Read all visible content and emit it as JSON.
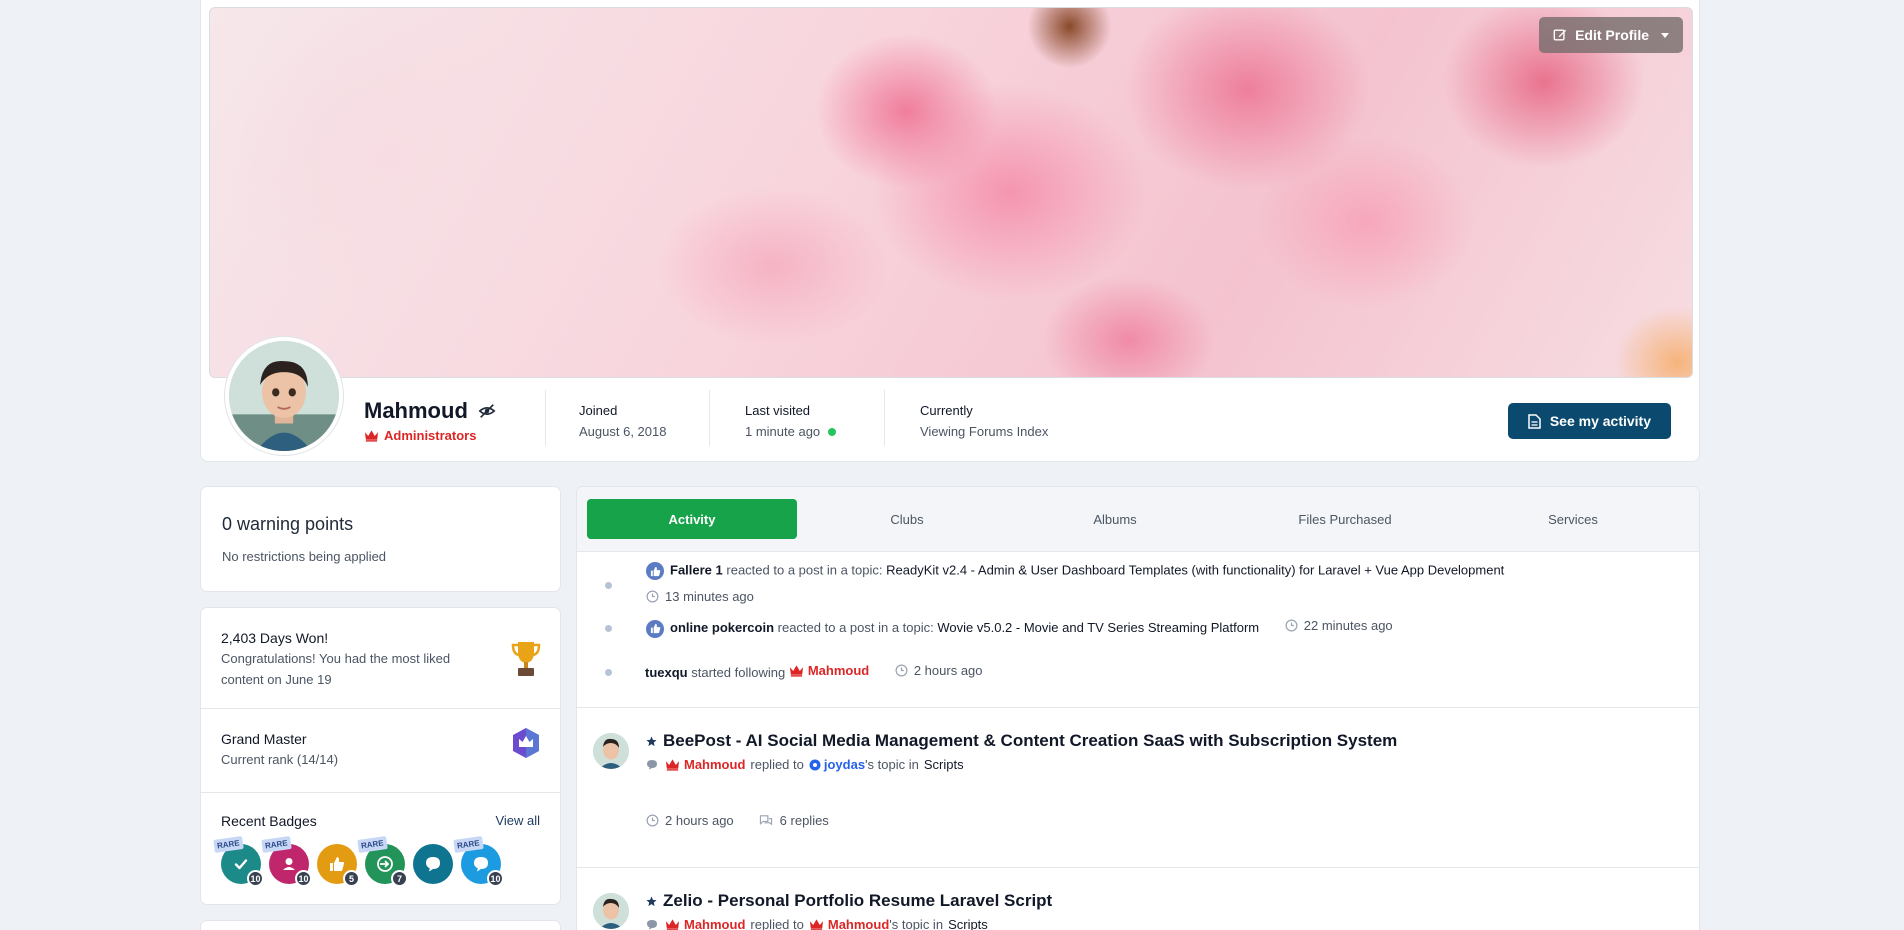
{
  "profile": {
    "edit_profile_label": "Edit Profile",
    "username": "Mahmoud",
    "group": "Administrators",
    "joined_label": "Joined",
    "joined_value": "August 6, 2018",
    "last_visited_label": "Last visited",
    "last_visited_value": "1 minute ago",
    "currently_label": "Currently",
    "currently_value": "Viewing Forums Index",
    "see_activity_label": "See my activity"
  },
  "sidebar": {
    "warnings_title": "0 warning points",
    "warnings_sub": "No restrictions being applied",
    "days_won_title": "2,403 Days Won!",
    "days_won_sub": "Congratulations! You had the most liked content on June 19",
    "rank_title": "Grand Master",
    "rank_sub": "Current rank (14/14)",
    "badges_title": "Recent Badges",
    "view_all_label": "View all",
    "badges": [
      {
        "icon": "check-icon",
        "color": "#1d8a8a",
        "count": "10",
        "rare": "RARE"
      },
      {
        "icon": "user-icon",
        "color": "#c0266b",
        "count": "10",
        "rare": "RARE"
      },
      {
        "icon": "thumbs-up-icon",
        "color": "#e39b12",
        "count": "5",
        "rare": ""
      },
      {
        "icon": "arrow-in-icon",
        "color": "#22945a",
        "count": "7",
        "rare": "RARE"
      },
      {
        "icon": "chat-icon",
        "color": "#0e7490",
        "count": "",
        "rare": ""
      },
      {
        "icon": "chat-icon",
        "color": "#1d9be0",
        "count": "10",
        "rare": "RARE"
      }
    ]
  },
  "tabs": [
    "Activity",
    "Clubs",
    "Albums",
    "Files Purchased",
    "Services"
  ],
  "feed": {
    "item1_user": "Fallere 1",
    "item1_action": "reacted to a post in a topic:",
    "item1_topic": "ReadyKit v2.4 - Admin & User Dashboard Templates (with functionality) for Laravel + Vue App Development",
    "item1_time": "13 minutes ago",
    "item2_user": "online pokercoin",
    "item2_action": "reacted to a post in a topic:",
    "item2_topic": "Wovie v5.0.2 - Movie and TV Series Streaming Platform",
    "item2_time": "22 minutes ago",
    "item3_user": "tuexqu",
    "item3_action": "started following",
    "item3_target": "Mahmoud",
    "item3_time": "2 hours ago",
    "post1_title": "BeePost - AI Social Media Management & Content Creation SaaS with Subscription System",
    "post1_user": "Mahmoud",
    "post1_action": "replied to",
    "post1_owner": "joydas",
    "post1_owner_suffix": "'s topic in",
    "post1_forum": "Scripts",
    "post1_time": "2 hours ago",
    "post1_replies": "6 replies",
    "post2_title": "Zelio - Personal Portfolio Resume Laravel Script",
    "post2_user": "Mahmoud",
    "post2_action": "replied to",
    "post2_owner": "Mahmoud",
    "post2_owner_suffix": "'s topic in",
    "post2_forum": "Scripts"
  }
}
